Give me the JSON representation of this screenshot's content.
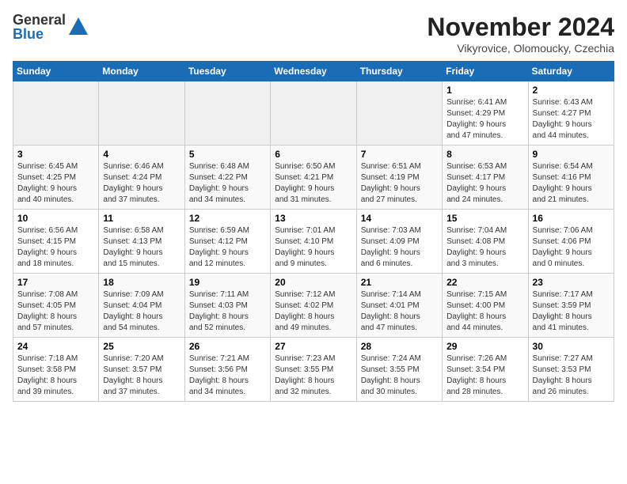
{
  "header": {
    "logo": {
      "line1": "General",
      "line2": "Blue"
    },
    "title": "November 2024",
    "location": "Vikyrovice, Olomoucky, Czechia"
  },
  "weekdays": [
    "Sunday",
    "Monday",
    "Tuesday",
    "Wednesday",
    "Thursday",
    "Friday",
    "Saturday"
  ],
  "weeks": [
    [
      {
        "day": "",
        "info": ""
      },
      {
        "day": "",
        "info": ""
      },
      {
        "day": "",
        "info": ""
      },
      {
        "day": "",
        "info": ""
      },
      {
        "day": "",
        "info": ""
      },
      {
        "day": "1",
        "info": "Sunrise: 6:41 AM\nSunset: 4:29 PM\nDaylight: 9 hours\nand 47 minutes."
      },
      {
        "day": "2",
        "info": "Sunrise: 6:43 AM\nSunset: 4:27 PM\nDaylight: 9 hours\nand 44 minutes."
      }
    ],
    [
      {
        "day": "3",
        "info": "Sunrise: 6:45 AM\nSunset: 4:25 PM\nDaylight: 9 hours\nand 40 minutes."
      },
      {
        "day": "4",
        "info": "Sunrise: 6:46 AM\nSunset: 4:24 PM\nDaylight: 9 hours\nand 37 minutes."
      },
      {
        "day": "5",
        "info": "Sunrise: 6:48 AM\nSunset: 4:22 PM\nDaylight: 9 hours\nand 34 minutes."
      },
      {
        "day": "6",
        "info": "Sunrise: 6:50 AM\nSunset: 4:21 PM\nDaylight: 9 hours\nand 31 minutes."
      },
      {
        "day": "7",
        "info": "Sunrise: 6:51 AM\nSunset: 4:19 PM\nDaylight: 9 hours\nand 27 minutes."
      },
      {
        "day": "8",
        "info": "Sunrise: 6:53 AM\nSunset: 4:17 PM\nDaylight: 9 hours\nand 24 minutes."
      },
      {
        "day": "9",
        "info": "Sunrise: 6:54 AM\nSunset: 4:16 PM\nDaylight: 9 hours\nand 21 minutes."
      }
    ],
    [
      {
        "day": "10",
        "info": "Sunrise: 6:56 AM\nSunset: 4:15 PM\nDaylight: 9 hours\nand 18 minutes."
      },
      {
        "day": "11",
        "info": "Sunrise: 6:58 AM\nSunset: 4:13 PM\nDaylight: 9 hours\nand 15 minutes."
      },
      {
        "day": "12",
        "info": "Sunrise: 6:59 AM\nSunset: 4:12 PM\nDaylight: 9 hours\nand 12 minutes."
      },
      {
        "day": "13",
        "info": "Sunrise: 7:01 AM\nSunset: 4:10 PM\nDaylight: 9 hours\nand 9 minutes."
      },
      {
        "day": "14",
        "info": "Sunrise: 7:03 AM\nSunset: 4:09 PM\nDaylight: 9 hours\nand 6 minutes."
      },
      {
        "day": "15",
        "info": "Sunrise: 7:04 AM\nSunset: 4:08 PM\nDaylight: 9 hours\nand 3 minutes."
      },
      {
        "day": "16",
        "info": "Sunrise: 7:06 AM\nSunset: 4:06 PM\nDaylight: 9 hours\nand 0 minutes."
      }
    ],
    [
      {
        "day": "17",
        "info": "Sunrise: 7:08 AM\nSunset: 4:05 PM\nDaylight: 8 hours\nand 57 minutes."
      },
      {
        "day": "18",
        "info": "Sunrise: 7:09 AM\nSunset: 4:04 PM\nDaylight: 8 hours\nand 54 minutes."
      },
      {
        "day": "19",
        "info": "Sunrise: 7:11 AM\nSunset: 4:03 PM\nDaylight: 8 hours\nand 52 minutes."
      },
      {
        "day": "20",
        "info": "Sunrise: 7:12 AM\nSunset: 4:02 PM\nDaylight: 8 hours\nand 49 minutes."
      },
      {
        "day": "21",
        "info": "Sunrise: 7:14 AM\nSunset: 4:01 PM\nDaylight: 8 hours\nand 47 minutes."
      },
      {
        "day": "22",
        "info": "Sunrise: 7:15 AM\nSunset: 4:00 PM\nDaylight: 8 hours\nand 44 minutes."
      },
      {
        "day": "23",
        "info": "Sunrise: 7:17 AM\nSunset: 3:59 PM\nDaylight: 8 hours\nand 41 minutes."
      }
    ],
    [
      {
        "day": "24",
        "info": "Sunrise: 7:18 AM\nSunset: 3:58 PM\nDaylight: 8 hours\nand 39 minutes."
      },
      {
        "day": "25",
        "info": "Sunrise: 7:20 AM\nSunset: 3:57 PM\nDaylight: 8 hours\nand 37 minutes."
      },
      {
        "day": "26",
        "info": "Sunrise: 7:21 AM\nSunset: 3:56 PM\nDaylight: 8 hours\nand 34 minutes."
      },
      {
        "day": "27",
        "info": "Sunrise: 7:23 AM\nSunset: 3:55 PM\nDaylight: 8 hours\nand 32 minutes."
      },
      {
        "day": "28",
        "info": "Sunrise: 7:24 AM\nSunset: 3:55 PM\nDaylight: 8 hours\nand 30 minutes."
      },
      {
        "day": "29",
        "info": "Sunrise: 7:26 AM\nSunset: 3:54 PM\nDaylight: 8 hours\nand 28 minutes."
      },
      {
        "day": "30",
        "info": "Sunrise: 7:27 AM\nSunset: 3:53 PM\nDaylight: 8 hours\nand 26 minutes."
      }
    ]
  ],
  "colors": {
    "header_bg": "#1a6db5",
    "odd_row": "#f9f9f9",
    "even_row": "#ffffff",
    "empty_cell": "#f0f0f0"
  }
}
